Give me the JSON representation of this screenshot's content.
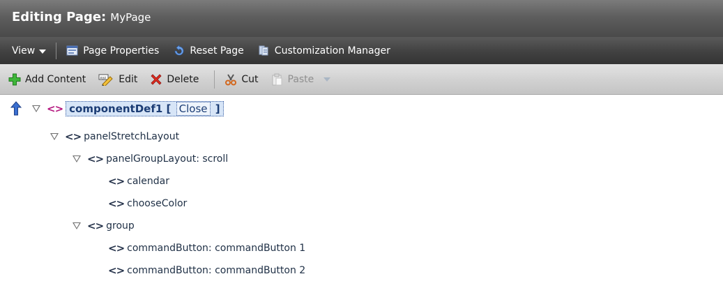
{
  "title": {
    "label": "Editing Page:",
    "page_name": "MyPage"
  },
  "customization_toolbar": {
    "view_label": "View",
    "page_properties_label": "Page Properties",
    "reset_page_label": "Reset Page",
    "customization_manager_label": "Customization Manager"
  },
  "edit_toolbar": {
    "add_content_label": "Add Content",
    "edit_label": "Edit",
    "delete_label": "Delete",
    "cut_label": "Cut",
    "paste_label": "Paste"
  },
  "tree": {
    "root": {
      "label": "componentDef1",
      "open_bracket": "[",
      "close_label": "Close",
      "close_bracket": "]"
    },
    "nodes": [
      {
        "label": "panelStretchLayout"
      },
      {
        "label": "panelGroupLayout: scroll"
      },
      {
        "label": "calendar"
      },
      {
        "label": "chooseColor"
      },
      {
        "label": "group"
      },
      {
        "label": "commandButton: commandButton 1"
      },
      {
        "label": "commandButton: commandButton 2"
      }
    ]
  },
  "colors": {
    "accent": "#b4177f",
    "selection": "#d7e5f7",
    "titlebar": "#5e5e5e"
  }
}
